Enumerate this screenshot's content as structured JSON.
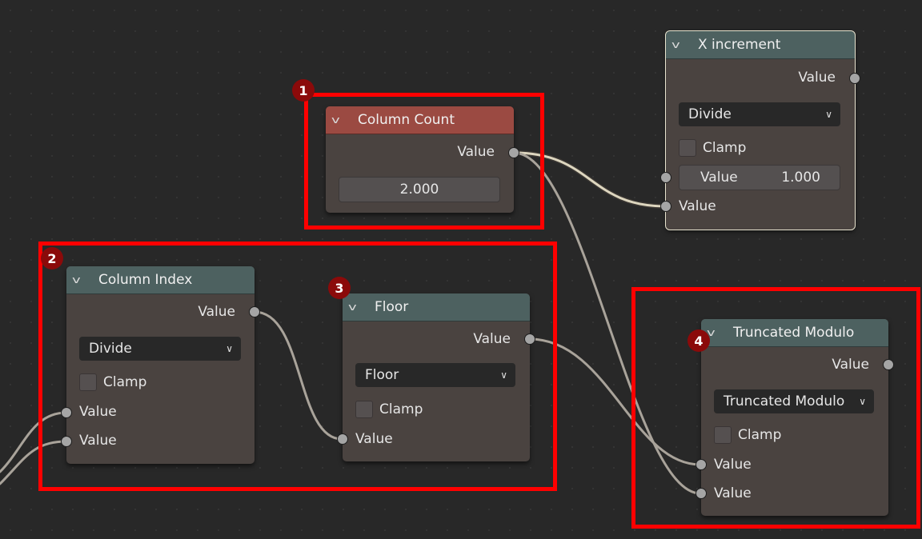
{
  "colors": {
    "annotation": "#ff0000",
    "badge": "#8b0a0a",
    "wire": "#c9c1ad",
    "header_math": "#4d6160",
    "header_input": "#9b4a42"
  },
  "annotations": [
    "1",
    "2",
    "3",
    "4"
  ],
  "nodes": {
    "column_count": {
      "title": "Column Count",
      "output": "Value",
      "value": "2.000"
    },
    "x_increment": {
      "title": "X increment",
      "output": "Value",
      "operation": "Divide",
      "clamp_label": "Clamp",
      "field_label": "Value",
      "field_value": "1.000",
      "input": "Value"
    },
    "column_index": {
      "title": "Column Index",
      "output": "Value",
      "operation": "Divide",
      "clamp_label": "Clamp",
      "input1": "Value",
      "input2": "Value"
    },
    "floor": {
      "title": "Floor",
      "output": "Value",
      "operation": "Floor",
      "clamp_label": "Clamp",
      "input": "Value"
    },
    "truncated_modulo": {
      "title": "Truncated Modulo",
      "output": "Value",
      "operation": "Truncated Modulo",
      "clamp_label": "Clamp",
      "input1": "Value",
      "input2": "Value"
    }
  }
}
